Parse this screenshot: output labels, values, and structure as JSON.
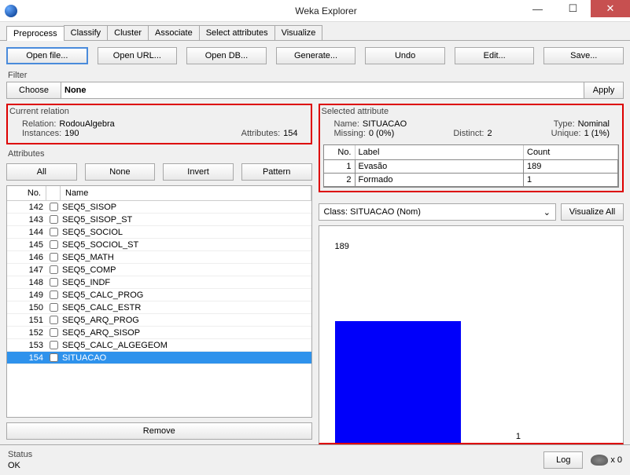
{
  "title": "Weka Explorer",
  "tabs": [
    "Preprocess",
    "Classify",
    "Cluster",
    "Associate",
    "Select attributes",
    "Visualize"
  ],
  "toolbar": {
    "open_file": "Open file...",
    "open_url": "Open URL...",
    "open_db": "Open DB...",
    "generate": "Generate...",
    "undo": "Undo",
    "edit": "Edit...",
    "save": "Save..."
  },
  "filter": {
    "label": "Filter",
    "choose": "Choose",
    "value": "None",
    "apply": "Apply"
  },
  "current_relation": {
    "title": "Current relation",
    "relation_k": "Relation:",
    "relation_v": "RodouAlgebra",
    "instances_k": "Instances:",
    "instances_v": "190",
    "attributes_k": "Attributes:",
    "attributes_v": "154"
  },
  "attributes": {
    "title": "Attributes",
    "all": "All",
    "none": "None",
    "invert": "Invert",
    "pattern": "Pattern",
    "remove": "Remove",
    "cols": {
      "no": "No.",
      "name": "Name"
    },
    "rows": [
      {
        "no": 142,
        "name": "SEQ5_SISOP"
      },
      {
        "no": 143,
        "name": "SEQ5_SISOP_ST"
      },
      {
        "no": 144,
        "name": "SEQ5_SOCIOL"
      },
      {
        "no": 145,
        "name": "SEQ5_SOCIOL_ST"
      },
      {
        "no": 146,
        "name": "SEQ5_MATH"
      },
      {
        "no": 147,
        "name": "SEQ5_COMP"
      },
      {
        "no": 148,
        "name": "SEQ5_INDF"
      },
      {
        "no": 149,
        "name": "SEQ5_CALC_PROG"
      },
      {
        "no": 150,
        "name": "SEQ5_CALC_ESTR"
      },
      {
        "no": 151,
        "name": "SEQ5_ARQ_PROG"
      },
      {
        "no": 152,
        "name": "SEQ5_ARQ_SISOP"
      },
      {
        "no": 153,
        "name": "SEQ5_CALC_ALGEGEOM"
      },
      {
        "no": 154,
        "name": "SITUACAO",
        "selected": true
      }
    ]
  },
  "selected_attribute": {
    "title": "Selected attribute",
    "name_k": "Name:",
    "name_v": "SITUACAO",
    "type_k": "Type:",
    "type_v": "Nominal",
    "missing_k": "Missing:",
    "missing_v": "0 (0%)",
    "distinct_k": "Distinct:",
    "distinct_v": "2",
    "unique_k": "Unique:",
    "unique_v": "1 (1%)",
    "cols": {
      "no": "No.",
      "label": "Label",
      "count": "Count"
    },
    "rows": [
      {
        "no": 1,
        "label": "Evasão",
        "count": 189
      },
      {
        "no": 2,
        "label": "Formado",
        "count": 1
      }
    ]
  },
  "class_select": {
    "value": "Class: SITUACAO (Nom)",
    "viz_all": "Visualize All"
  },
  "status": {
    "label": "Status",
    "value": "OK",
    "log": "Log",
    "x": "x 0"
  },
  "chart_data": {
    "type": "bar",
    "categories": [
      "Evasão",
      "Formado"
    ],
    "values": [
      189,
      1
    ],
    "title": "",
    "xlabel": "",
    "ylabel": "",
    "ylim": [
      0,
      189
    ]
  }
}
